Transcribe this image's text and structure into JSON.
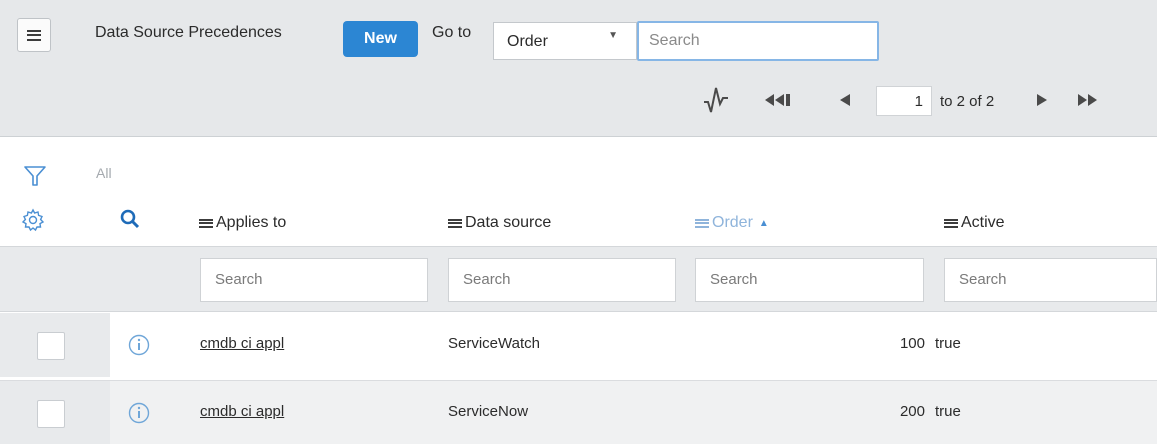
{
  "header": {
    "list_title": "Data Source Precedences",
    "new_label": "New",
    "goto_label": "Go to",
    "goto_field": "Order",
    "search_placeholder": "Search"
  },
  "pager": {
    "page_value": "1",
    "range_text": "to 2 of 2"
  },
  "filter": {
    "label": "All"
  },
  "columns": [
    {
      "label": "Applies to",
      "search_placeholder": "Search"
    },
    {
      "label": "Data source",
      "search_placeholder": "Search"
    },
    {
      "label": "Order",
      "search_placeholder": "Search",
      "sorted": "ascending"
    },
    {
      "label": "Active",
      "search_placeholder": "Search"
    }
  ],
  "rows": [
    {
      "applies_to": "cmdb ci appl",
      "data_source": "ServiceWatch",
      "order": "100",
      "active": "true"
    },
    {
      "applies_to": "cmdb ci appl",
      "data_source": "ServiceNow",
      "order": "200",
      "active": "true"
    }
  ],
  "colors": {
    "primary": "#2c86d3",
    "sorted_column": "#8fb4db",
    "info_icon": "#6fa6d8"
  }
}
